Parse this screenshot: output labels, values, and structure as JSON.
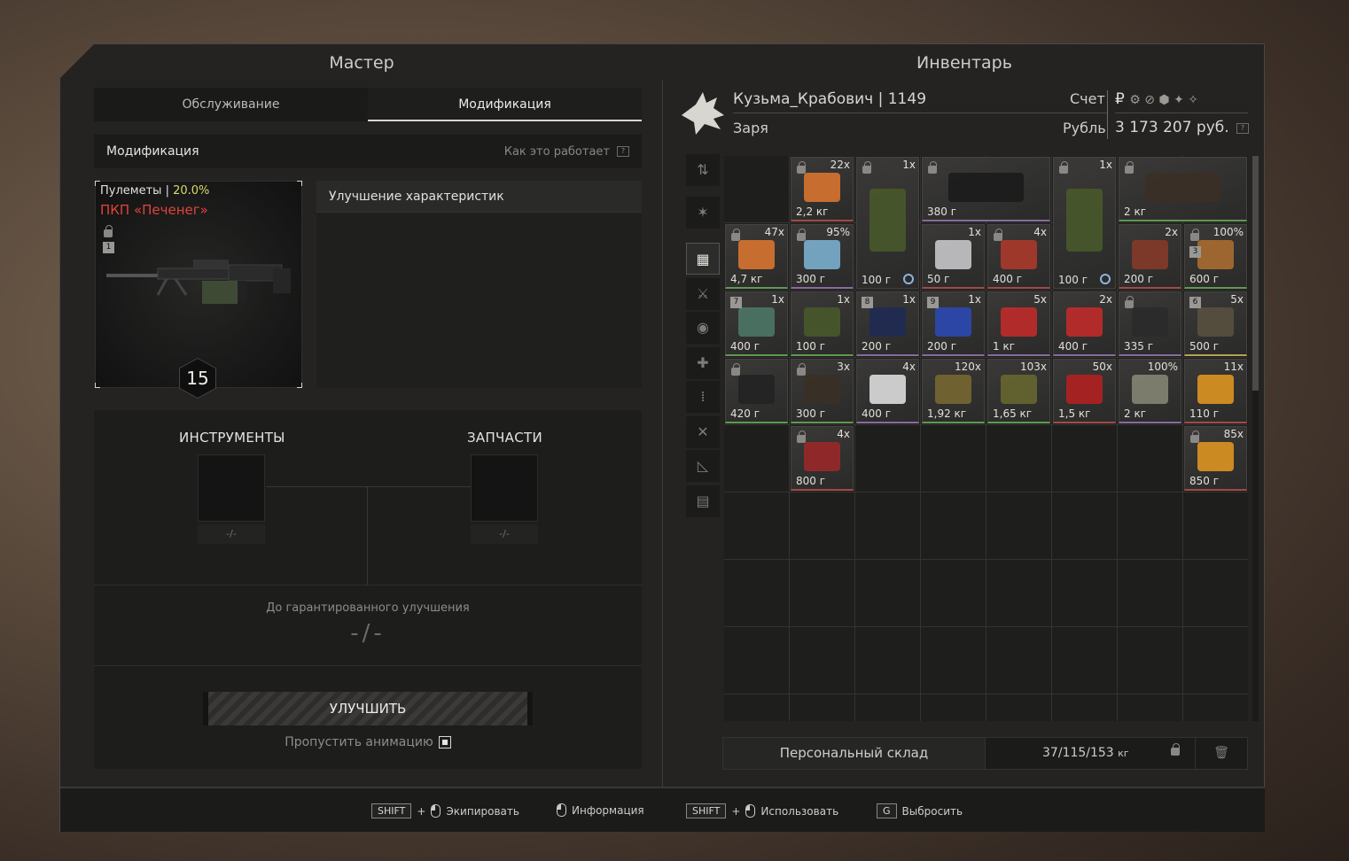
{
  "left": {
    "title": "Мастер",
    "tabs": [
      "Обслуживание",
      "Модификация"
    ],
    "bar_title": "Модификация",
    "bar_help": "Как это работает",
    "weapon": {
      "category": "Пулеметы",
      "category_sep": "|",
      "percent": "20.0%",
      "name": "ПКП «Печенег»",
      "slot_num": "1",
      "level": "15"
    },
    "improve_title": "Улучшение характеристик",
    "tools_label": "ИНСТРУМЕНТЫ",
    "parts_label": "ЗАПЧАСТИ",
    "tools_value": "-/-",
    "parts_value": "-/-",
    "guarantee_label": "До гарантированного улучшения",
    "guarantee_value": "-/-",
    "upgrade_btn": "УЛУЧШИТЬ",
    "skip_anim": "Пропустить анимацию"
  },
  "right": {
    "title": "Инвентарь",
    "player_name": "Кузьма_Крабович | 1149",
    "faction": "Заря",
    "account_label": "Счет",
    "currency_label": "Рубль",
    "currency_sign": "₽",
    "balance": "3 173 207 руб.",
    "stash_name": "Персональный склад",
    "weight": "37/115/153",
    "weight_unit": "кг"
  },
  "footer": {
    "k1": "SHIFT",
    "plus": "+",
    "equip": "Экипировать",
    "info": "Информация",
    "k2": "SHIFT",
    "use": "Использовать",
    "k3": "G",
    "drop": "Выбросить"
  },
  "items": [
    {
      "c": "22x",
      "p": "2,2 кг",
      "lock": true
    },
    {
      "c": "1x",
      "p": "100 г",
      "lock": true,
      "clock": true
    },
    {
      "c": "",
      "p": "380 г",
      "lock": true
    },
    {
      "c": "1x",
      "p": "100 г",
      "lock": true,
      "clock": true
    },
    {
      "c": "",
      "p": "2 кг",
      "lock": true
    },
    {
      "c": "47x",
      "p": "4,7 кг",
      "lock": true
    },
    {
      "c": "95%",
      "p": "300 г",
      "lock": true
    },
    {
      "c": "1x",
      "p": "50 г"
    },
    {
      "c": "4x",
      "p": "400 г",
      "lock": true
    },
    {
      "c": "2x",
      "p": "200 г"
    },
    {
      "c": "100%",
      "p": "600 г",
      "lock": true,
      "bn": "3"
    },
    {
      "c": "1x",
      "p": "400 г",
      "bn": "7"
    },
    {
      "c": "1x",
      "p": "100 г"
    },
    {
      "c": "1x",
      "p": "200 г",
      "bn": "8"
    },
    {
      "c": "1x",
      "p": "200 г",
      "bn": "9"
    },
    {
      "c": "5x",
      "p": "1 кг"
    },
    {
      "c": "2x",
      "p": "400 г"
    },
    {
      "c": "",
      "p": "335 г",
      "lock": true
    },
    {
      "c": "5x",
      "p": "500 г",
      "bn": "6"
    },
    {
      "c": "",
      "p": "420 г",
      "lock": true
    },
    {
      "c": "3x",
      "p": "300 г",
      "lock": true
    },
    {
      "c": "4x",
      "p": "400 г"
    },
    {
      "c": "120x",
      "p": "1,92 кг"
    },
    {
      "c": "103x",
      "p": "1,65 кг"
    },
    {
      "c": "50x",
      "p": "1,5 кг"
    },
    {
      "c": "100%",
      "p": "2 кг"
    },
    {
      "c": "11x",
      "p": "110 г"
    },
    {
      "c": "4x",
      "p": "800 г",
      "lock": true
    },
    {
      "c": "85x",
      "p": "850 г",
      "lock": true
    }
  ]
}
